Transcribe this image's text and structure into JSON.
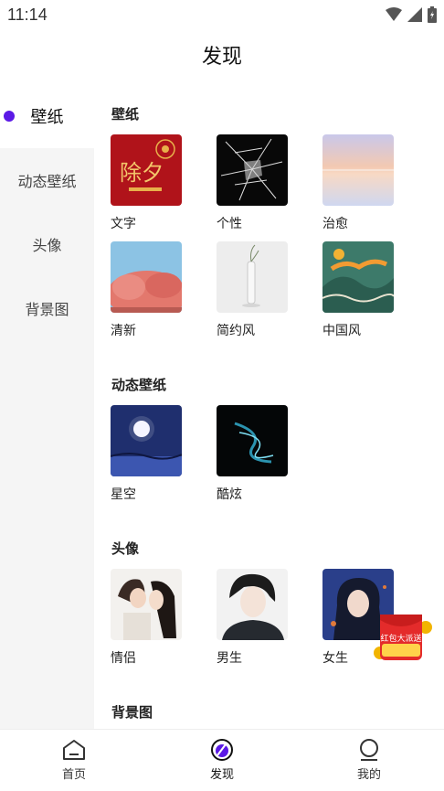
{
  "status": {
    "time": "11:14"
  },
  "header": {
    "title": "发现"
  },
  "sidebar": {
    "items": [
      {
        "label": "壁纸",
        "active": true
      },
      {
        "label": "动态壁纸",
        "active": false
      },
      {
        "label": "头像",
        "active": false
      },
      {
        "label": "背景图",
        "active": false
      }
    ]
  },
  "sections": [
    {
      "title": "壁纸",
      "tiles": [
        {
          "label": "文字",
          "badge": "除夕"
        },
        {
          "label": "个性",
          "badge": "破碎玻璃"
        },
        {
          "label": "治愈"
        },
        {
          "label": "清新"
        },
        {
          "label": "简约风"
        },
        {
          "label": "中国风"
        }
      ]
    },
    {
      "title": "动态壁纸",
      "tiles": [
        {
          "label": "星空"
        },
        {
          "label": "酷炫"
        }
      ]
    },
    {
      "title": "头像",
      "tiles": [
        {
          "label": "情侣"
        },
        {
          "label": "男生"
        },
        {
          "label": "女生"
        }
      ]
    },
    {
      "title": "背景图",
      "tiles": []
    }
  ],
  "redpacket": {
    "text": "红包大派送"
  },
  "bottom_nav": {
    "items": [
      {
        "label": "首页",
        "icon": "home-icon",
        "active": false
      },
      {
        "label": "发现",
        "icon": "discover-icon",
        "active": true
      },
      {
        "label": "我的",
        "icon": "profile-icon",
        "active": false
      }
    ]
  },
  "colors": {
    "accent": "#5b19e6",
    "sidebar_bg": "#f5f5f5"
  }
}
